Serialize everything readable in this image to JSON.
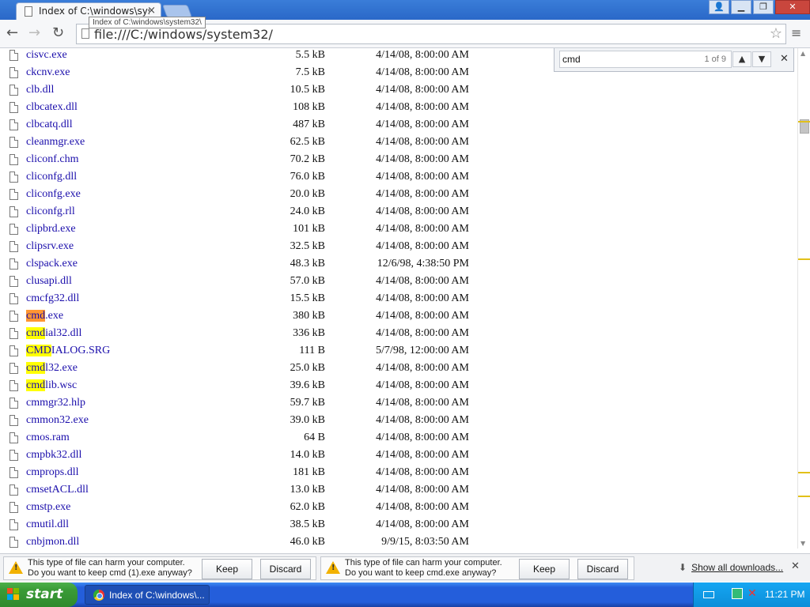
{
  "tab": {
    "title": "Index of C:\\windows\\system32\\",
    "close": "×"
  },
  "tooltip": "Index of C:\\windows\\system32\\",
  "window_buttons": {
    "profile": "👤",
    "minimize": "▁",
    "maximize": "❐",
    "close": "✕"
  },
  "toolbar": {
    "back": "←",
    "forward": "→",
    "reload": "↻",
    "url": "file:///C:/windows/system32/",
    "star": "☆",
    "menu": "≡"
  },
  "find": {
    "query": "cmd",
    "count": "1 of 9",
    "prev": "▲",
    "next": "▼",
    "close": "✕"
  },
  "files": [
    {
      "name": "cisvc.exe",
      "size": "5.5 kB",
      "date": "4/14/08, 8:00:00 AM"
    },
    {
      "name": "ckcnv.exe",
      "size": "7.5 kB",
      "date": "4/14/08, 8:00:00 AM"
    },
    {
      "name": "clb.dll",
      "size": "10.5 kB",
      "date": "4/14/08, 8:00:00 AM"
    },
    {
      "name": "clbcatex.dll",
      "size": "108 kB",
      "date": "4/14/08, 8:00:00 AM"
    },
    {
      "name": "clbcatq.dll",
      "size": "487 kB",
      "date": "4/14/08, 8:00:00 AM"
    },
    {
      "name": "cleanmgr.exe",
      "size": "62.5 kB",
      "date": "4/14/08, 8:00:00 AM"
    },
    {
      "name": "cliconf.chm",
      "size": "70.2 kB",
      "date": "4/14/08, 8:00:00 AM"
    },
    {
      "name": "cliconfg.dll",
      "size": "76.0 kB",
      "date": "4/14/08, 8:00:00 AM"
    },
    {
      "name": "cliconfg.exe",
      "size": "20.0 kB",
      "date": "4/14/08, 8:00:00 AM"
    },
    {
      "name": "cliconfg.rll",
      "size": "24.0 kB",
      "date": "4/14/08, 8:00:00 AM"
    },
    {
      "name": "clipbrd.exe",
      "size": "101 kB",
      "date": "4/14/08, 8:00:00 AM"
    },
    {
      "name": "clipsrv.exe",
      "size": "32.5 kB",
      "date": "4/14/08, 8:00:00 AM"
    },
    {
      "name": "clspack.exe",
      "size": "48.3 kB",
      "date": "12/6/98, 4:38:50 PM"
    },
    {
      "name": "clusapi.dll",
      "size": "57.0 kB",
      "date": "4/14/08, 8:00:00 AM"
    },
    {
      "name": "cmcfg32.dll",
      "size": "15.5 kB",
      "date": "4/14/08, 8:00:00 AM"
    },
    {
      "name": "cmd.exe",
      "size": "380 kB",
      "date": "4/14/08, 8:00:00 AM",
      "match": "cmd",
      "active": true
    },
    {
      "name": "cmdial32.dll",
      "size": "336 kB",
      "date": "4/14/08, 8:00:00 AM",
      "match": "cmd"
    },
    {
      "name": "CMDIALOG.SRG",
      "size": "111 B",
      "date": "5/7/98, 12:00:00 AM",
      "match": "CMD"
    },
    {
      "name": "cmdl32.exe",
      "size": "25.0 kB",
      "date": "4/14/08, 8:00:00 AM",
      "match": "cmd"
    },
    {
      "name": "cmdlib.wsc",
      "size": "39.6 kB",
      "date": "4/14/08, 8:00:00 AM",
      "match": "cmd"
    },
    {
      "name": "cmmgr32.hlp",
      "size": "59.7 kB",
      "date": "4/14/08, 8:00:00 AM"
    },
    {
      "name": "cmmon32.exe",
      "size": "39.0 kB",
      "date": "4/14/08, 8:00:00 AM"
    },
    {
      "name": "cmos.ram",
      "size": "64 B",
      "date": "4/14/08, 8:00:00 AM"
    },
    {
      "name": "cmpbk32.dll",
      "size": "14.0 kB",
      "date": "4/14/08, 8:00:00 AM"
    },
    {
      "name": "cmprops.dll",
      "size": "181 kB",
      "date": "4/14/08, 8:00:00 AM"
    },
    {
      "name": "cmsetACL.dll",
      "size": "13.0 kB",
      "date": "4/14/08, 8:00:00 AM"
    },
    {
      "name": "cmstp.exe",
      "size": "62.0 kB",
      "date": "4/14/08, 8:00:00 AM"
    },
    {
      "name": "cmutil.dll",
      "size": "38.5 kB",
      "date": "4/14/08, 8:00:00 AM"
    },
    {
      "name": "cnbjmon.dll",
      "size": "46.0 kB",
      "date": "9/9/15, 8:03:50 AM"
    }
  ],
  "scrollbar": {
    "up": "▲",
    "down": "▼"
  },
  "downloads": [
    {
      "line1": "This type of file can harm your computer.",
      "line2": "Do you want to keep cmd (1).exe anyway?",
      "keep": "Keep",
      "discard": "Discard"
    },
    {
      "line1": "This type of file can harm your computer.",
      "line2": "Do you want to keep cmd.exe anyway?",
      "keep": "Keep",
      "discard": "Discard"
    }
  ],
  "shelf": {
    "show_all": "Show all downloads...",
    "download_icon": "⬇",
    "close": "✕"
  },
  "taskbar": {
    "start": "start",
    "task_label": "Index of C:\\windows\\...",
    "clock": "11:21 PM"
  },
  "colors": {
    "match_highlight": "#ffff00",
    "active_match": "#ff9632",
    "link": "#1a0dab"
  }
}
